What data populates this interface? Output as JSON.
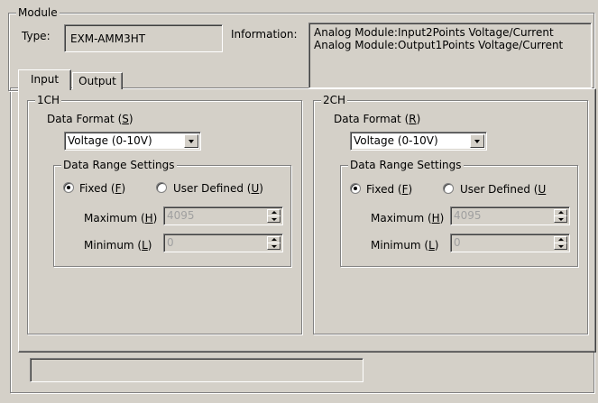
{
  "module": {
    "group_label": "Module",
    "type_label": "Type:",
    "type_value": "EXM-AMM3HT",
    "info_label": "Information:",
    "info_lines": [
      "Analog Module:Input2Points Voltage/Current",
      "Analog Module:Output1Points Voltage/Current"
    ]
  },
  "tabs": [
    {
      "label": "Input",
      "selected": true
    },
    {
      "label": "Output",
      "selected": false
    }
  ],
  "channels": [
    {
      "name": "1CH",
      "data_format_label": "Data Format (S)",
      "data_format_label_pre": "Data Format (",
      "data_format_key": "S",
      "data_format_label_post": ")",
      "data_format_value": "Voltage (0-10V)",
      "range_group_label": "Data Range Settings",
      "fixed_label_pre": "Fixed (",
      "fixed_key": "F",
      "fixed_label_post": ")",
      "fixed_selected": true,
      "user_label_pre": "User Defined (",
      "user_key": "U",
      "user_label_post": ")",
      "user_selected": false,
      "max_label_pre": "Maximum (",
      "max_key": "H",
      "max_label_post": ")",
      "max_value": "4095",
      "min_label_pre": "Minimum (",
      "min_key": "L",
      "min_label_post": ")",
      "min_value": "0"
    },
    {
      "name": "2CH",
      "data_format_label": "Data Format (R)",
      "data_format_label_pre": "Data Format (",
      "data_format_key": "R",
      "data_format_label_post": ")",
      "data_format_value": "Voltage (0-10V)",
      "range_group_label": "Data Range Settings",
      "fixed_label_pre": "Fixed (",
      "fixed_key": "F",
      "fixed_label_post": ")",
      "fixed_selected": true,
      "user_label_pre": "User  Defined (",
      "user_key": "U",
      "user_label_post": "",
      "user_selected": false,
      "max_label_pre": "Maximum (",
      "max_key": "H",
      "max_label_post": ")",
      "max_value": "4095",
      "min_label_pre": "Minimum (",
      "min_key": "L",
      "min_label_post": ")",
      "min_value": "0"
    }
  ],
  "status_text": "",
  "colors": {
    "face": "#d4d0c8",
    "shadow": "#808080",
    "highlight": "#ffffff",
    "disabled_text": "#a0a0a0"
  }
}
